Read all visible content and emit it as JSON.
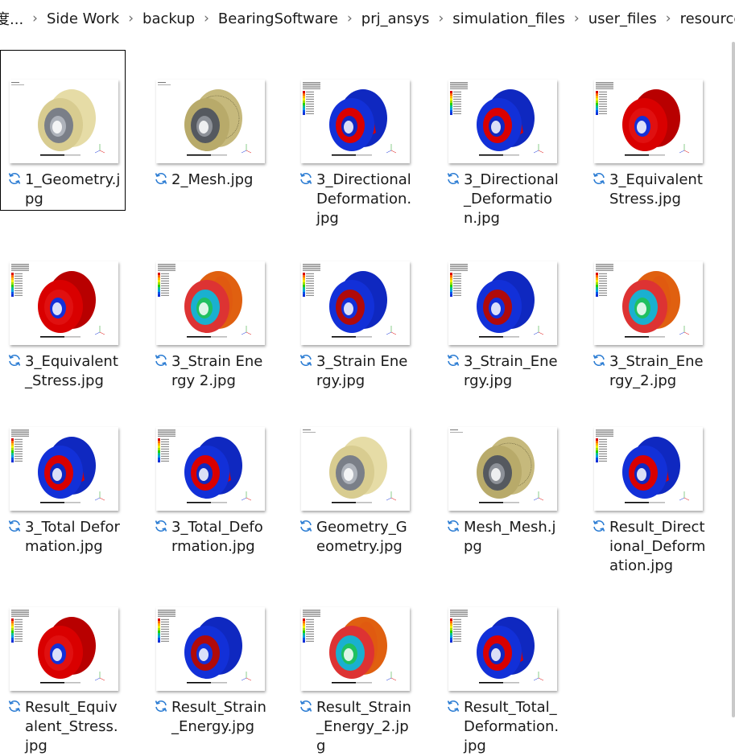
{
  "breadcrumb": [
    "度...",
    "Side Work",
    "backup",
    "BearingSoftware",
    "prj_ansys",
    "simulation_files",
    "user_files",
    "resources"
  ],
  "files": [
    {
      "name": "1_Geometry.jpg",
      "style": "geometry",
      "selected": true
    },
    {
      "name": "2_Mesh.jpg",
      "style": "mesh"
    },
    {
      "name": "3_Directional Deformation.jpg",
      "style": "blue-red"
    },
    {
      "name": "3_Directional_Deformation.jpg",
      "style": "blue-red"
    },
    {
      "name": "3_Equivalent Stress.jpg",
      "style": "red"
    },
    {
      "name": "3_Equivalent_Stress.jpg",
      "style": "red"
    },
    {
      "name": "3_Strain Energy 2.jpg",
      "style": "strain-band"
    },
    {
      "name": "3_Strain Energy.jpg",
      "style": "blue-dots"
    },
    {
      "name": "3_Strain_Energy.jpg",
      "style": "blue-dots"
    },
    {
      "name": "3_Strain_Energy_2.jpg",
      "style": "strain-band"
    },
    {
      "name": "3_Total Deformation.jpg",
      "style": "blue-red2"
    },
    {
      "name": "3_Total_Deformation.jpg",
      "style": "blue-red2"
    },
    {
      "name": "Geometry_Geometry.jpg",
      "style": "geometry"
    },
    {
      "name": "Mesh_Mesh.jpg",
      "style": "mesh"
    },
    {
      "name": "Result_Directional_Deformation.jpg",
      "style": "blue-red"
    },
    {
      "name": "Result_Equivalent_Stress.jpg",
      "style": "red"
    },
    {
      "name": "Result_Strain_Energy.jpg",
      "style": "blue-dots"
    },
    {
      "name": "Result_Strain_Energy_2.jpg",
      "style": "strain-band"
    },
    {
      "name": "Result_Total_Deformation.jpg",
      "style": "blue-red2"
    }
  ],
  "colors": {
    "sync_icon": "#2b7cd3",
    "red": "#d90000",
    "blue": "#1230d8",
    "gold": "#d8cc90",
    "gray": "#7a7f88"
  }
}
